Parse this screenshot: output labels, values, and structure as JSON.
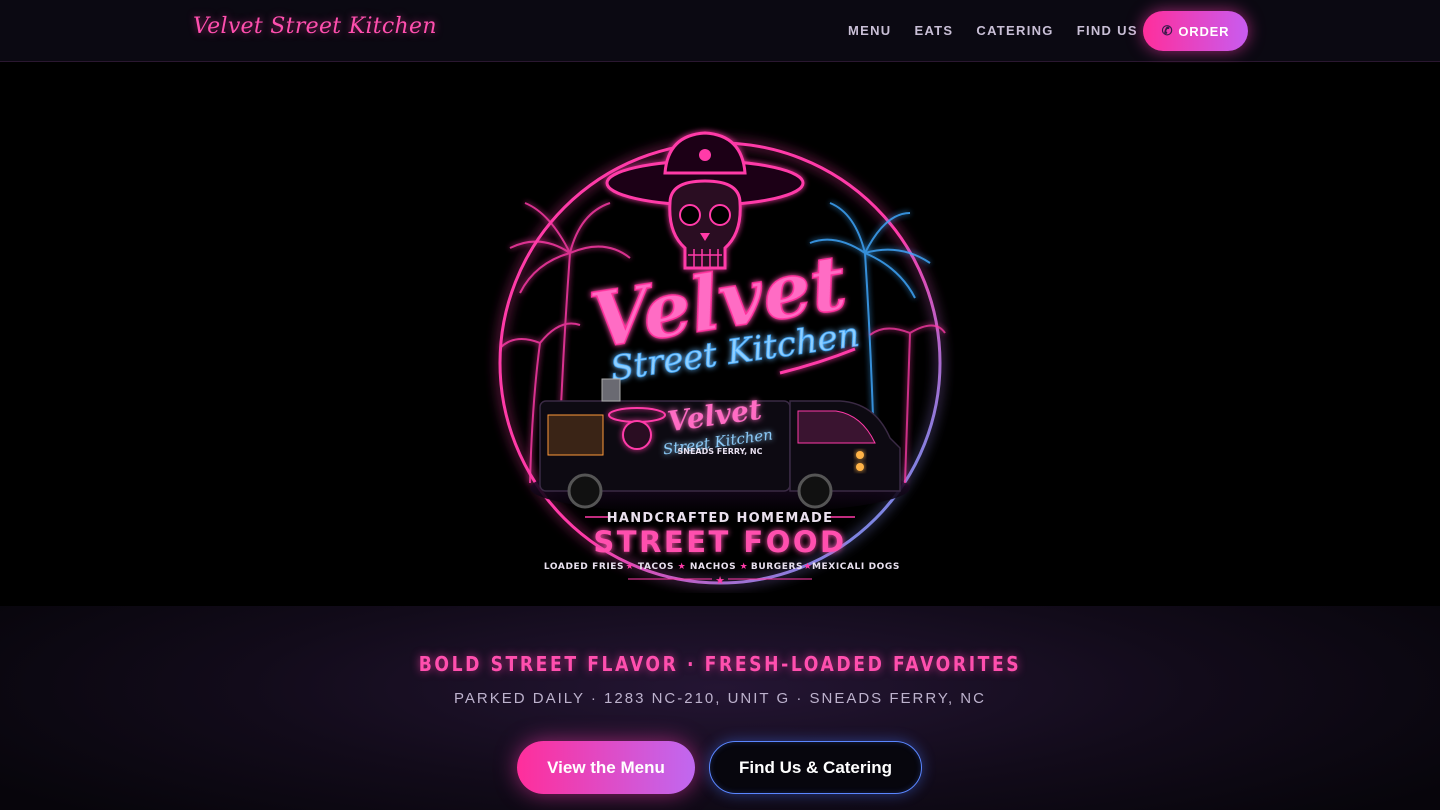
{
  "header": {
    "brand": "Velvet Street Kitchen",
    "nav": [
      {
        "label": "MENU"
      },
      {
        "label": "EATS"
      },
      {
        "label": "CATERING"
      },
      {
        "label": "FIND US"
      }
    ],
    "order_label": "ORDER",
    "order_icon": "phone-icon"
  },
  "logo": {
    "title_main": "Velvet",
    "title_sub": "Street Kitchen",
    "truck_title": "Velvet",
    "truck_sub": "Street Kitchen",
    "truck_location": "SNEADS FERRY, NC",
    "kicker": "HANDCRAFTED HOMEMADE",
    "headline": "STREET FOOD",
    "items": [
      "LOADED FRIES",
      "TACOS",
      "NACHOS",
      "BURGERS",
      "MEXICALI DOGS"
    ]
  },
  "hero": {
    "tagline": "BOLD STREET FLAVOR · FRESH-LOADED FAVORITES",
    "address": "PARKED DAILY · 1283 NC-210, UNIT G · SNEADS FERRY, NC",
    "primary_cta": "View the Menu",
    "secondary_cta": "Find Us & Catering"
  },
  "colors": {
    "neon_pink": "#ff3aa8",
    "neon_blue": "#3fa9ff",
    "background": "#000000",
    "header_bg": "#0b0912"
  }
}
